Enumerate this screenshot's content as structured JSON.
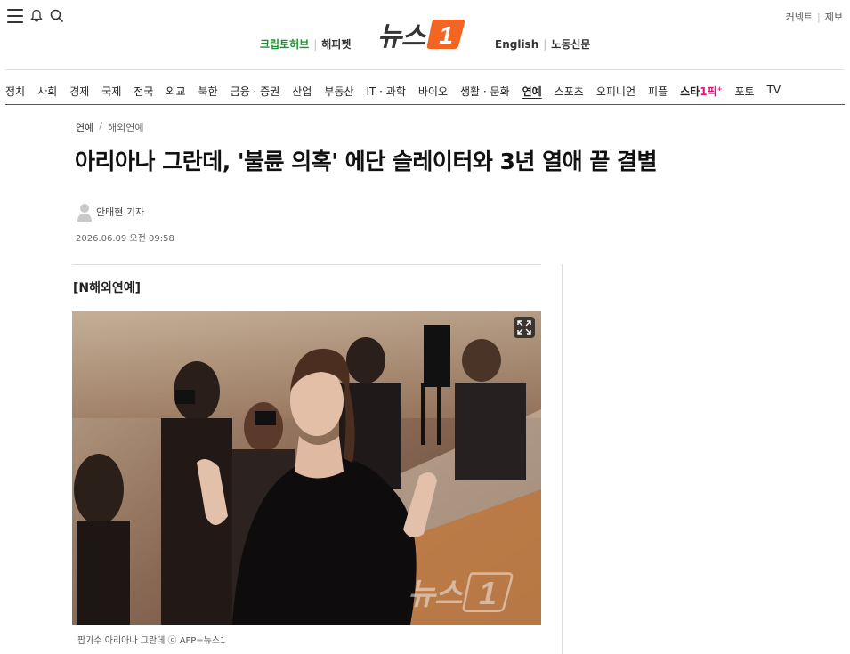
{
  "header": {
    "top_right": {
      "connect": "커넥트",
      "report": "제보"
    },
    "util_left": {
      "crypto": "크립토허브",
      "happy": "해피펫"
    },
    "logo": {
      "text": "뉴스",
      "mark": "1"
    },
    "util_right": {
      "english": "English",
      "labor": "노동신문"
    },
    "icons": [
      "menu-icon",
      "bell-icon",
      "search-icon"
    ]
  },
  "nav": {
    "items": [
      "정치",
      "사회",
      "경제",
      "국제",
      "전국",
      "외교",
      "북한",
      "금융 · 증권",
      "산업",
      "부동산",
      "IT · 과학",
      "바이오",
      "생활 · 문화",
      "연예",
      "스포츠",
      "오피니언",
      "피플",
      "포토",
      "TV"
    ],
    "active": "연예",
    "star": {
      "prefix": "스타",
      "pick": "1픽",
      "plus": "+"
    }
  },
  "article": {
    "breadcrumb": {
      "section": "연예",
      "subsection": "해외연예"
    },
    "title": "아리아나 그란데, '불륜 의혹' 에단 슬레이터와 3년 열애 끝 결별",
    "author": "안태현 기자",
    "date": "2026.06.09 오전 09:58",
    "section_label": "[N해외연예]",
    "caption": "팝가수 아리아나 그란데 ⓒ AFP=뉴스1",
    "watermark": "뉴스"
  },
  "colors": {
    "accent": "#f26522",
    "green": "#1e8f2e",
    "star_pink": "#e0157a"
  }
}
